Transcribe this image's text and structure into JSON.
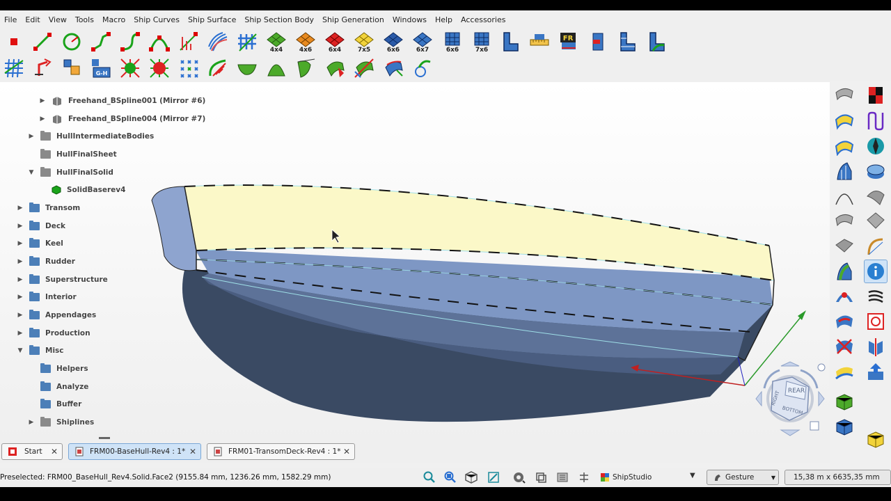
{
  "menu": [
    "File",
    "Edit",
    "View",
    "Tools",
    "Macro",
    "Ship Curves",
    "Ship Surface",
    "Ship Section Body",
    "Ship Generation",
    "Windows",
    "Help",
    "Accessories"
  ],
  "toolbar1_icons": [
    "stop-macro-icon",
    "line-curve-icon",
    "circle-curve-icon",
    "polyline-curve-icon",
    "bspline-curve-icon",
    "bezier-curve-icon",
    "interpolate-curve-icon",
    "curve-network-icon",
    "mesh-grid-icon",
    "patch-4x4-icon",
    "patch-4x6-icon",
    "patch-6x4-icon",
    "patch-7x5-icon",
    "patch-6x6-icon",
    "patch-6x7-icon",
    "panel-6x6-icon",
    "panel-7x6-icon",
    "section-body-icon",
    "section-ruler-icon",
    "frame-fr-icon",
    "section-red-icon",
    "section-stack-icon",
    "section-green-icon"
  ],
  "toolbar1_labels": {
    "patch_4x4": "4x4",
    "patch_4x6": "4x6",
    "patch_6x4": "6x4",
    "patch_7x5": "7x5",
    "patch_6x6": "6x6",
    "patch_6x7": "6x7",
    "panel_6x6": "6x6",
    "panel_7x6": "7x6",
    "frame_fr": "FR"
  },
  "toolbar2_icons": [
    "grid-icon",
    "rotate-arrow-icon",
    "cube-stack-icon",
    "g-h-icon",
    "net-green-icon",
    "net-red-icon",
    "scatter-points-icon",
    "surface-curve-icon",
    "hull-shape-icon",
    "bow-shape-icon",
    "leaf-surface-icon",
    "patch-red-icon",
    "patch-mirror-icon",
    "patch-blue-icon",
    "rotate-surface-icon"
  ],
  "toolbar2_labels": {
    "g_h": "G-H"
  },
  "tree": [
    {
      "label": "Freehand_BSpline001 (Mirror #6)",
      "type": "sketch"
    },
    {
      "label": "Freehand_BSpline004 (Mirror #7)",
      "type": "sketch"
    },
    {
      "label": "HullIntermediateBodies",
      "type": "grey"
    },
    {
      "label": "HullFinalSheet",
      "type": "grey"
    },
    {
      "label": "HullFinalSolid",
      "type": "grey"
    },
    {
      "label": "SolidBaserev4",
      "type": "solid"
    },
    {
      "label": "Transom",
      "type": "blue"
    },
    {
      "label": "Deck",
      "type": "blue"
    },
    {
      "label": "Keel",
      "type": "blue"
    },
    {
      "label": "Rudder",
      "type": "blue"
    },
    {
      "label": "Superstructure",
      "type": "blue"
    },
    {
      "label": "Interior",
      "type": "blue"
    },
    {
      "label": "Appendages",
      "type": "blue"
    },
    {
      "label": "Production",
      "type": "blue"
    },
    {
      "label": "Misc",
      "type": "blue"
    },
    {
      "label": "Helpers",
      "type": "blue"
    },
    {
      "label": "Analyze",
      "type": "blue"
    },
    {
      "label": "Buffer",
      "type": "blue"
    },
    {
      "label": "Shiplines",
      "type": "grey"
    }
  ],
  "navcube": {
    "top_face": "REAR",
    "left_face": "RIGHT",
    "bottom_face": "BOTTOM"
  },
  "right_icons": [
    "sweep-surface-icon",
    "checker-red-icon",
    "loft-surface-icon",
    "u-curve-icon",
    "blend-surface-icon",
    "compass-icon",
    "profile-surface-icon",
    "cylinder-cut-icon",
    "curve-arc-icon",
    "sheet-grey-icon",
    "wave-surface-icon",
    "sheet-fold-icon",
    "sheet-flat-icon",
    "curve-hook-icon",
    "surface-green-icon",
    "info-icon",
    "arch-red-icon",
    "zebra-icon",
    "patch-red-blue-icon",
    "square-circle-icon",
    "cross-patch-icon",
    "mirror-plane-icon",
    "yellow-surface-icon",
    "extrude-blue-icon",
    "green-cube-icon",
    "blue-cube-icon",
    "yellow-cubes-icon"
  ],
  "tabs": [
    {
      "label": "Start"
    },
    {
      "label": "FRM00-BaseHull-Rev4 : 1*"
    },
    {
      "label": "FRM01-TransomDeck-Rev4 : 1*"
    }
  ],
  "status": {
    "preselected": "Preselected: FRM00_BaseHull_Rev4.Solid.Face2 (9155.84 mm, 1236.26 mm, 1582.29 mm)",
    "workbench": "ShipStudio",
    "navigation": "Gesture",
    "dimensions": "15,38 m x 6635,35 mm"
  },
  "status_icons": [
    "zoom-fit-icon",
    "zoom-selection-icon",
    "isometric-view-icon",
    "measure-icon",
    "draw-style-icon",
    "view-cube-icon",
    "stereo-icon",
    "clipping-icon"
  ],
  "colors": {
    "folder_blue": "#4c7fb8",
    "folder_grey": "#8a8a8a",
    "hull_top": "#fbf8c8",
    "hull_mid": "#7e97c4",
    "hull_bottom": "#3a4a63",
    "active_tab": "#cfe3f7"
  }
}
